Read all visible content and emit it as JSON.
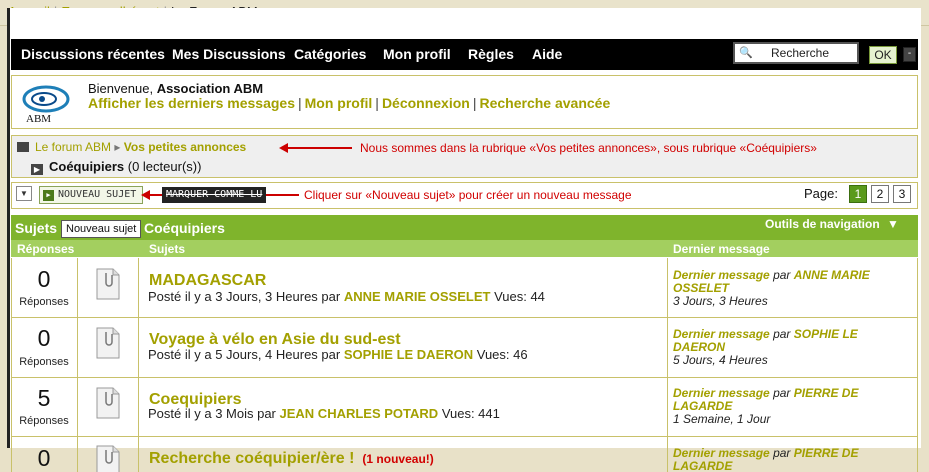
{
  "breadcrumb": {
    "home": "Accueil",
    "member": "Espace adhérent",
    "forum": "Le Forum ABM",
    "sep": "|"
  },
  "nav": {
    "items": [
      "Discussions récentes",
      "Mes Discussions",
      "Catégories",
      "Mon profil",
      "Règles",
      "Aide"
    ]
  },
  "search": {
    "label": "Recherche",
    "ok": "OK",
    "minimize": "-"
  },
  "welcome": {
    "greeting": "Bienvenue,",
    "user": "Association ABM",
    "links": [
      "Afficher les derniers messages",
      "Mon profil",
      "Déconnexion",
      "Recherche avancée"
    ],
    "sep": "|",
    "logo_text": "ABM"
  },
  "location": {
    "forum": "Le forum ABM",
    "section": "Vos petites annonces",
    "subsection": "Coéquipiers",
    "readers": "(0 lecteur(s))"
  },
  "annotations": {
    "location": "Nous sommes dans la rubrique «Vos petites annonces», sous rubrique «Coéquipiers»",
    "new_topic": "Cliquer sur «Nouveau sujet» pour créer un nouveau message"
  },
  "toolbar": {
    "new_topic": "NOUVEAU SUJET",
    "mark_read": "MARQUER COMME LU",
    "page_label": "Page:",
    "pages": [
      "1",
      "2",
      "3"
    ]
  },
  "table": {
    "header_left": "Sujets",
    "header_title": "Coéquipiers",
    "tools": "Outils de navigation",
    "tooltip": "Nouveau sujet",
    "col_replies": "Réponses",
    "col_topics": "Sujets",
    "col_last": "Dernier message"
  },
  "topics": [
    {
      "replies": "0",
      "replies_label": "Réponses",
      "title": "MADAGASCAR",
      "new_badge": "",
      "meta_prefix": "Posté il y a 3 Jours, 3 Heures par",
      "author": "ANNE MARIE OSSELET",
      "views": "Vues: 44",
      "last_label": "Dernier message",
      "last_par": "par",
      "last_author": "ANNE MARIE OSSELET",
      "last_when": "3 Jours, 3 Heures"
    },
    {
      "replies": "0",
      "replies_label": "Réponses",
      "title": "Voyage à vélo en Asie du sud-est",
      "new_badge": "",
      "meta_prefix": "Posté il y a 5 Jours, 4 Heures par",
      "author": "SOPHIE LE DAERON",
      "views": "Vues: 46",
      "last_label": "Dernier message",
      "last_par": "par",
      "last_author": "SOPHIE LE DAERON",
      "last_when": "5 Jours, 4 Heures"
    },
    {
      "replies": "5",
      "replies_label": "Réponses",
      "title": "Coequipiers",
      "new_badge": "",
      "meta_prefix": "Posté il y a 3 Mois par",
      "author": "JEAN CHARLES POTARD",
      "views": "Vues: 441",
      "last_label": "Dernier message",
      "last_par": "par",
      "last_author": "PIERRE DE LAGARDE",
      "last_when": "1 Semaine, 1 Jour"
    },
    {
      "replies": "0",
      "replies_label": "Réponses",
      "title": "Recherche coéquipier/ère !",
      "new_badge": "(1 nouveau!)",
      "meta_prefix": "",
      "author": "",
      "views": "",
      "last_label": "Dernier message",
      "last_par": "par",
      "last_author": "PIERRE DE LAGARDE",
      "last_when": ""
    }
  ],
  "colors": {
    "accent": "#a3a000",
    "green": "#7fb42c",
    "annotation": "#d10000"
  }
}
